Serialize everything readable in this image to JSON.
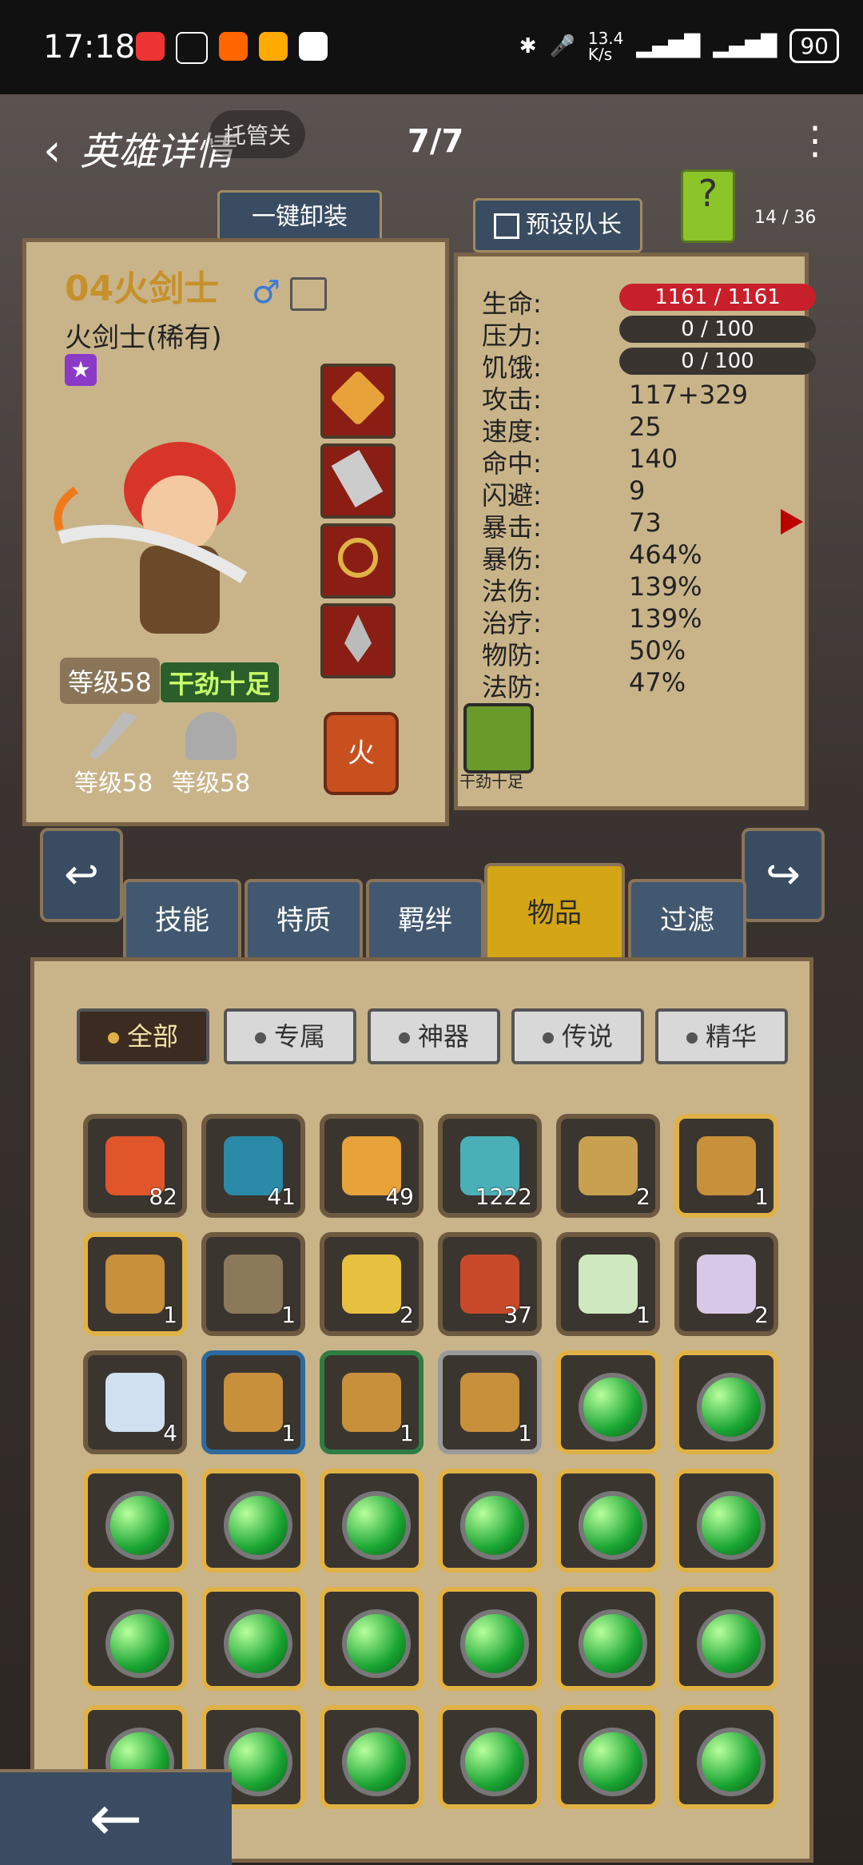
{
  "status_bar": {
    "time": "17:18",
    "net_speed": "13.4\nK/s",
    "battery": "90"
  },
  "header": {
    "back_label": "英雄详情",
    "trustee": "托管关",
    "pager": "7/7",
    "menu": "⋮"
  },
  "top_buttons": {
    "unequip_all": "一键卸装",
    "preset_leader": "预设队长",
    "help": "?",
    "count": "14 / 36"
  },
  "hero": {
    "name": "04火剑士",
    "class": "火剑士(稀有)",
    "star": "★",
    "level": "等级58",
    "buff": "干劲十足",
    "gear": [
      {
        "level": "等级58",
        "icon": "sword-icon"
      },
      {
        "level": "等级58",
        "icon": "helmet-icon"
      }
    ],
    "element": "火",
    "slots": [
      {
        "icon": "staff-icon"
      },
      {
        "icon": "dagger-icon"
      },
      {
        "icon": "bow-icon"
      },
      {
        "icon": "spear-icon"
      }
    ]
  },
  "stats": [
    {
      "label": "生命:",
      "value": "1161 / 1161",
      "bar": "red"
    },
    {
      "label": "压力:",
      "value": "0 / 100",
      "bar": "dark"
    },
    {
      "label": "饥饿:",
      "value": "0 / 100",
      "bar": "dark"
    },
    {
      "label": "攻击:",
      "value": "117+329"
    },
    {
      "label": "速度:",
      "value": "25"
    },
    {
      "label": "命中:",
      "value": "140"
    },
    {
      "label": "闪避:",
      "value": "9"
    },
    {
      "label": "暴击:",
      "value": "73"
    },
    {
      "label": "暴伤:",
      "value": "464%"
    },
    {
      "label": "法伤:",
      "value": "139%"
    },
    {
      "label": "治疗:",
      "value": "139%"
    },
    {
      "label": "物防:",
      "value": "50%"
    },
    {
      "label": "法防:",
      "value": "47%"
    }
  ],
  "buff_icon_label": "干劲十足",
  "tabs": [
    {
      "label": "技能"
    },
    {
      "label": "特质"
    },
    {
      "label": "羁绊"
    },
    {
      "label": "物品",
      "active": true
    },
    {
      "label": "过滤"
    }
  ],
  "filters": [
    {
      "label": "全部",
      "active": true
    },
    {
      "label": "专属"
    },
    {
      "label": "神器"
    },
    {
      "label": "传说"
    },
    {
      "label": "精华"
    }
  ],
  "items": [
    {
      "icon": "red-gem-icon",
      "qty": "82",
      "border": "brown"
    },
    {
      "icon": "blue-rune-icon",
      "qty": "41",
      "border": "brown"
    },
    {
      "icon": "feather-gold-icon",
      "qty": "49",
      "border": "brown"
    },
    {
      "icon": "potion-icon",
      "qty": "1222",
      "border": "brown"
    },
    {
      "icon": "gold-medal-icon",
      "qty": "2",
      "border": "brown"
    },
    {
      "icon": "gold-chest-icon",
      "qty": "1",
      "border": "gold"
    },
    {
      "icon": "gold-chest-icon",
      "qty": "1",
      "border": "gold"
    },
    {
      "icon": "scroll-icon",
      "qty": "1",
      "border": "brown"
    },
    {
      "icon": "ticket-icon",
      "qty": "2",
      "border": "brown"
    },
    {
      "icon": "skull-icon",
      "qty": "37",
      "border": "brown"
    },
    {
      "icon": "green-feather-icon",
      "qty": "1",
      "border": "brown"
    },
    {
      "icon": "purple-feather-icon",
      "qty": "2",
      "border": "brown"
    },
    {
      "icon": "blue-feather-icon",
      "qty": "4",
      "border": "brown"
    },
    {
      "icon": "blue-chest-icon",
      "qty": "1",
      "border": "blue"
    },
    {
      "icon": "green-chest-icon",
      "qty": "1",
      "border": "green"
    },
    {
      "icon": "gray-chest-icon",
      "qty": "1",
      "border": "gray"
    },
    {
      "icon": "green-orb-icon",
      "qty": "",
      "border": "gold"
    },
    {
      "icon": "green-orb-icon",
      "qty": "",
      "border": "gold"
    },
    {
      "icon": "green-orb-icon",
      "qty": "",
      "border": "gold"
    },
    {
      "icon": "green-orb-icon",
      "qty": "",
      "border": "gold"
    },
    {
      "icon": "green-orb-icon",
      "qty": "",
      "border": "gold"
    },
    {
      "icon": "green-orb-icon",
      "qty": "",
      "border": "gold"
    },
    {
      "icon": "green-orb-icon",
      "qty": "",
      "border": "gold"
    },
    {
      "icon": "green-orb-icon",
      "qty": "",
      "border": "gold"
    },
    {
      "icon": "green-orb-icon",
      "qty": "",
      "border": "gold"
    },
    {
      "icon": "green-orb-icon",
      "qty": "",
      "border": "gold"
    },
    {
      "icon": "green-orb-icon",
      "qty": "",
      "border": "gold"
    },
    {
      "icon": "green-orb-icon",
      "qty": "",
      "border": "gold"
    },
    {
      "icon": "green-orb-icon",
      "qty": "",
      "border": "gold"
    },
    {
      "icon": "green-orb-icon",
      "qty": "",
      "border": "gold"
    },
    {
      "icon": "green-orb-icon",
      "qty": "",
      "border": "gold"
    },
    {
      "icon": "green-orb-icon",
      "qty": "",
      "border": "gold"
    },
    {
      "icon": "green-orb-icon",
      "qty": "",
      "border": "gold"
    },
    {
      "icon": "green-orb-icon",
      "qty": "",
      "border": "gold"
    },
    {
      "icon": "green-orb-icon",
      "qty": "",
      "border": "gold"
    },
    {
      "icon": "green-orb-icon",
      "qty": "",
      "border": "gold"
    }
  ],
  "bottom_back_icon": "←"
}
